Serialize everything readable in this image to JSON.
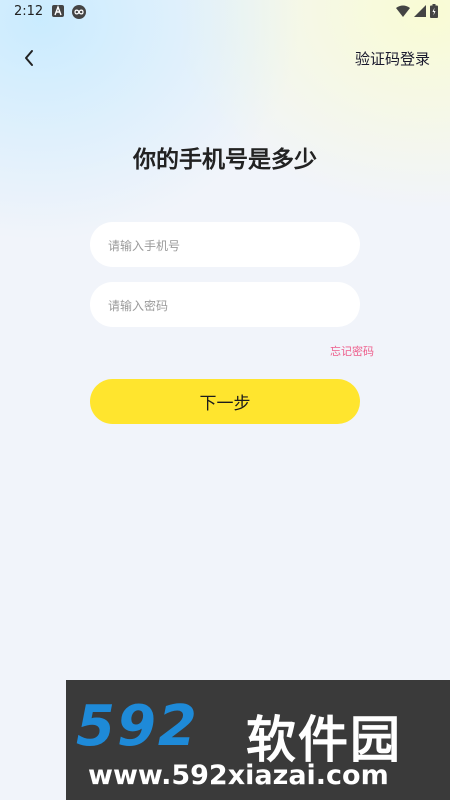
{
  "status_bar": {
    "time": "2:12"
  },
  "header": {
    "back_icon": "chevron-left-icon",
    "sms_login_label": "验证码登录"
  },
  "main": {
    "title": "你的手机号是多少",
    "phone_input": {
      "placeholder": "请输入手机号",
      "value": ""
    },
    "password_input": {
      "placeholder": "请输入密码",
      "value": ""
    },
    "forgot_password_label": "忘记密码",
    "next_button_label": "下一步"
  },
  "watermark": {
    "number": "592",
    "brand_cn": "软件园",
    "url": "www.592xiazai.com"
  },
  "colors": {
    "accent_yellow": "#ffe52e",
    "link_pink": "#ee5d8b",
    "watermark_blue": "#1e8ad8"
  }
}
